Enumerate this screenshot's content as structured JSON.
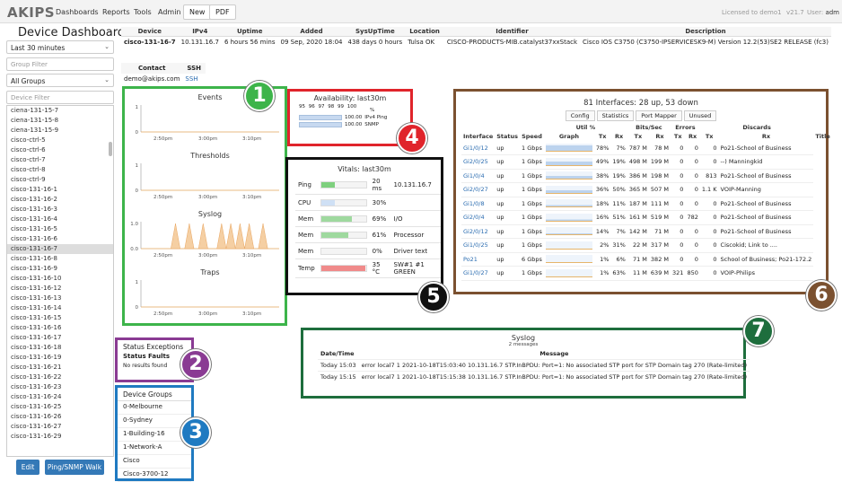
{
  "app": {
    "logo": "AKIPS",
    "version": "v21.7",
    "licensed": "Licensed to demo1",
    "user_label": "User:",
    "user": "adm"
  },
  "nav": {
    "items": [
      "Dashboards",
      "Reports",
      "Tools",
      "Admin"
    ],
    "new": "New",
    "pdf": "PDF"
  },
  "sidebar": {
    "title": "Device Dashboard",
    "period": "Last 30 minutes",
    "group_filter_placeholder": "Group Filter",
    "groups_select": "All Groups",
    "device_filter_placeholder": "Device Filter",
    "devices": [
      "ciena-131-15-7",
      "ciena-131-15-8",
      "ciena-131-15-9",
      "cisco-ctrl-5",
      "cisco-ctrl-6",
      "cisco-ctrl-7",
      "cisco-ctrl-8",
      "cisco-ctrl-9",
      "cisco-131-16-1",
      "cisco-131-16-2",
      "cisco-131-16-3",
      "cisco-131-16-4",
      "cisco-131-16-5",
      "cisco-131-16-6",
      "cisco-131-16-7",
      "cisco-131-16-8",
      "cisco-131-16-9",
      "cisco-131-16-10",
      "cisco-131-16-12",
      "cisco-131-16-13",
      "cisco-131-16-14",
      "cisco-131-16-15",
      "cisco-131-16-16",
      "cisco-131-16-17",
      "cisco-131-16-18",
      "cisco-131-16-19",
      "cisco-131-16-21",
      "cisco-131-16-22",
      "cisco-131-16-23",
      "cisco-131-16-24",
      "cisco-131-16-25",
      "cisco-131-16-26",
      "cisco-131-16-27",
      "cisco-131-16-29"
    ],
    "selected_device": "cisco-131-16-7",
    "edit_button": "Edit",
    "walk_button": "Ping/SNMP Walk"
  },
  "device": {
    "headers": [
      "Device",
      "IPv4",
      "Uptime",
      "Added",
      "SysUpTime",
      "Location",
      "Identifier",
      "Description"
    ],
    "values": [
      "cisco-131-16-7",
      "10.131.16.7",
      "6 hours 56 mins",
      "09 Sep, 2020 18:04",
      "438 days 0 hours",
      "Tulsa OK",
      "CISCO-PRODUCTS-MIB.catalyst37xxStack",
      "Cisco IOS C3750 (C3750-IPSERVICESK9-M) Version 12.2(53)SE2 RELEASE (fc3)"
    ],
    "contact_header": "Contact",
    "ssh_header": "SSH",
    "contact": "demo@akips.com",
    "ssh": "SSH"
  },
  "charts": {
    "time_labels": [
      "2:50pm",
      "3:00pm",
      "3:10pm"
    ],
    "panels": [
      {
        "title": "Events",
        "ymax": "1",
        "ymin": "0",
        "values": [
          0,
          0,
          0,
          0,
          0,
          0,
          0,
          0,
          0,
          0,
          0,
          0,
          0,
          0,
          0,
          0,
          0,
          0,
          0,
          0,
          0,
          0,
          0,
          0,
          0,
          0,
          0,
          0,
          0,
          0
        ]
      },
      {
        "title": "Thresholds",
        "ymax": "1",
        "ymin": "0",
        "values": [
          0,
          0,
          0,
          0,
          0,
          0,
          0,
          0,
          0,
          0,
          0,
          0,
          0,
          0,
          0,
          0,
          0,
          0,
          0,
          0,
          0,
          0,
          0,
          0,
          0,
          0,
          0,
          0,
          0,
          0
        ]
      },
      {
        "title": "Syslog",
        "ymax": "1.0",
        "ymin": "0.0",
        "values": [
          0,
          0,
          0,
          0,
          0,
          0,
          0,
          1,
          0,
          0,
          1,
          0,
          0,
          1,
          0,
          0,
          0,
          1,
          0,
          1,
          0,
          1,
          0,
          1,
          0,
          0,
          1,
          0,
          0,
          0
        ]
      },
      {
        "title": "Traps",
        "ymax": "1",
        "ymin": "0",
        "values": [
          0,
          0,
          0,
          0,
          0,
          0,
          0,
          0,
          0,
          0,
          0,
          0,
          0,
          0,
          0,
          0,
          0,
          0,
          0,
          0,
          0,
          0,
          0,
          0,
          0,
          0,
          0,
          0,
          0,
          0
        ]
      }
    ]
  },
  "status_exceptions": {
    "title": "Status Exceptions",
    "col1": "Status",
    "col2": "Faults",
    "empty": "No results found"
  },
  "device_groups": {
    "title": "Device Groups",
    "items": [
      "0-Melbourne",
      "0-Sydney",
      "1-Building-16",
      "1-Network-A",
      "Cisco",
      "Cisco-3700-12"
    ]
  },
  "availability": {
    "title": "Availability: last30m",
    "scale": [
      "95",
      "96",
      "97",
      "98",
      "99",
      "100"
    ],
    "pct_symbol": "%",
    "rows": [
      {
        "value": "100.00",
        "label": "IPv4 Ping"
      },
      {
        "value": "100.00",
        "label": "SNMP"
      }
    ]
  },
  "vitals": {
    "title": "Vitals: last30m",
    "rows": [
      {
        "name": "Ping",
        "value": "20 ms",
        "extra": "10.131.16.7",
        "fill": 0.3,
        "color": "#7ed07e"
      },
      {
        "name": "CPU",
        "value": "30%",
        "extra": "",
        "fill": 0.3,
        "color": "#cfe0f5"
      },
      {
        "name": "Mem",
        "value": "69%",
        "extra": "I/O",
        "fill": 0.69,
        "color": "#9fd99f"
      },
      {
        "name": "Mem",
        "value": "61%",
        "extra": "Processor",
        "fill": 0.61,
        "color": "#9fd99f"
      },
      {
        "name": "Mem",
        "value": "0%",
        "extra": "Driver text",
        "fill": 0,
        "color": "#9fd99f"
      },
      {
        "name": "Temp",
        "value": "35 °C",
        "extra": "SW#1 #1 GREEN",
        "fill": 0.99,
        "color": "#f08a8a"
      }
    ]
  },
  "interfaces": {
    "title": "81 Interfaces: 28 up, 53 down",
    "tabs": [
      "Config",
      "Statistics",
      "Port Mapper",
      "Unused"
    ],
    "group_headers": [
      "Util %",
      "Bits/Sec",
      "Errors",
      "Discards"
    ],
    "col_headers": [
      "Interface",
      "Status",
      "Speed",
      "Graph",
      "Tx",
      "Rx",
      "Tx",
      "Rx",
      "Tx",
      "Rx",
      "Tx",
      "Rx",
      "Title"
    ],
    "rows": [
      [
        "Gi1/0/12",
        "up",
        "1 Gbps",
        "78%",
        "7%",
        "787 M",
        "78 M",
        "0",
        "0",
        "0",
        "Po21-School of Business"
      ],
      [
        "Gi2/0/25",
        "up",
        "1 Gbps",
        "49%",
        "19%",
        "498 M",
        "199 M",
        "0",
        "0",
        "0",
        "--) Manningkid"
      ],
      [
        "Gi1/0/4",
        "up",
        "1 Gbps",
        "38%",
        "19%",
        "386 M",
        "198 M",
        "0",
        "0",
        "813",
        "Po21-School of Business"
      ],
      [
        "Gi2/0/27",
        "up",
        "1 Gbps",
        "36%",
        "50%",
        "365 M",
        "507 M",
        "0",
        "0",
        "1.1 K",
        "VOIP-Manning"
      ],
      [
        "Gi1/0/8",
        "up",
        "1 Gbps",
        "18%",
        "11%",
        "187 M",
        "111 M",
        "0",
        "0",
        "0",
        "Po21-School of Business"
      ],
      [
        "Gi2/0/4",
        "up",
        "1 Gbps",
        "16%",
        "51%",
        "161 M",
        "519 M",
        "0",
        "782",
        "0",
        "Po21-School of Business"
      ],
      [
        "Gi2/0/12",
        "up",
        "1 Gbps",
        "14%",
        "7%",
        "142 M",
        "71 M",
        "0",
        "0",
        "0",
        "Po21-School of Business"
      ],
      [
        "Gi1/0/25",
        "up",
        "1 Gbps",
        "2%",
        "31%",
        "22 M",
        "317 M",
        "0",
        "0",
        "0",
        "Ciscokid; Link to ...."
      ],
      [
        "Po21",
        "up",
        "6 Gbps",
        "1%",
        "6%",
        "71 M",
        "382 M",
        "0",
        "0",
        "0",
        "School of Business; Po21-172.2"
      ],
      [
        "Gi1/0/27",
        "up",
        "1 Gbps",
        "1%",
        "63%",
        "11 M",
        "639 M",
        "321",
        "850",
        "0",
        "VOIP-Philips"
      ]
    ]
  },
  "syslog": {
    "title": "Syslog",
    "count": "2 messages",
    "headers": [
      "Date/Time",
      "Message"
    ],
    "rows": [
      {
        "time": "Today 15:03",
        "msg": "error local7 1 2021-10-18T15:03:40 10.131.16.7 STP.InBPDU: Port=1: No associated STP port for STP Domain tag 270 (Rate-limited)"
      },
      {
        "time": "Today 15:15",
        "msg": "error local7 1 2021-10-18T15:15:38 10.131.16.7 STP.InBPDU: Port=1: No associated STP port for STP Domain tag 270 (Rate-limited)"
      }
    ]
  },
  "callouts": [
    {
      "n": "1",
      "color": "#3db44a"
    },
    {
      "n": "2",
      "color": "#8a3b93"
    },
    {
      "n": "3",
      "color": "#1f7ac1"
    },
    {
      "n": "4",
      "color": "#e0242b"
    },
    {
      "n": "5",
      "color": "#111111"
    },
    {
      "n": "6",
      "color": "#7b5130"
    },
    {
      "n": "7",
      "color": "#1e6e3d"
    }
  ]
}
